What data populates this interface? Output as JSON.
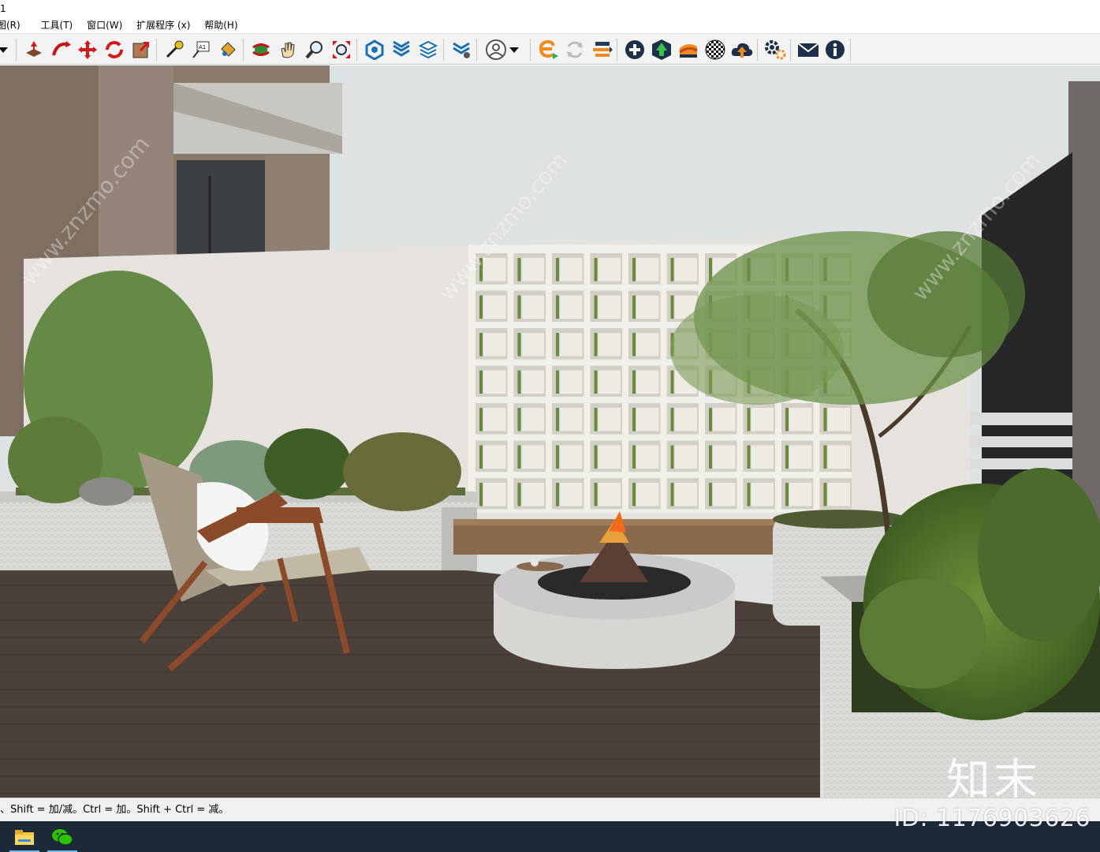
{
  "window": {
    "title_fragment": "1"
  },
  "menu": {
    "items": [
      "图(R)",
      "工具(T)",
      "窗口(W)",
      "扩展程序 (x)",
      "帮助(H)"
    ]
  },
  "toolbar": {
    "icons": [
      "dropdown-arrow-icon",
      "push-pull-icon",
      "follow-me-icon",
      "move-icon",
      "rotate-icon",
      "scale-icon",
      "tape-measure-icon",
      "text-label-icon",
      "paint-bucket-icon",
      "orbit-icon",
      "pan-hand-icon",
      "zoom-icon",
      "zoom-extents-icon",
      "warehouse-icon",
      "layers-icon",
      "layer-stack-icon",
      "tag-settings-icon",
      "user-account-icon",
      "user-dropdown-icon",
      "enscape-start-icon",
      "enscape-sync-icon",
      "enscape-export-icon",
      "add-circle-icon",
      "upload-tree-icon",
      "material-palette-icon",
      "checker-material-icon",
      "cloud-upload-icon",
      "gear-settings-icon",
      "mail-icon",
      "info-icon"
    ]
  },
  "status": {
    "hint": "、Shift = 加/减。Ctrl = 加。Shift + Ctrl = 减。"
  },
  "taskbar": {
    "apps": [
      "file-explorer-icon",
      "wechat-icon"
    ]
  },
  "watermark": {
    "site": "www.znzmo.com",
    "logo_text": "知末",
    "id_text": "ID: 1176903626"
  },
  "colors": {
    "toolbar_bg": "#f3f3f3",
    "taskbar_bg": "#1c2a38",
    "deck": "#4a3f3a",
    "wall": "#e6e3df",
    "sky": "#dfe2e2"
  }
}
